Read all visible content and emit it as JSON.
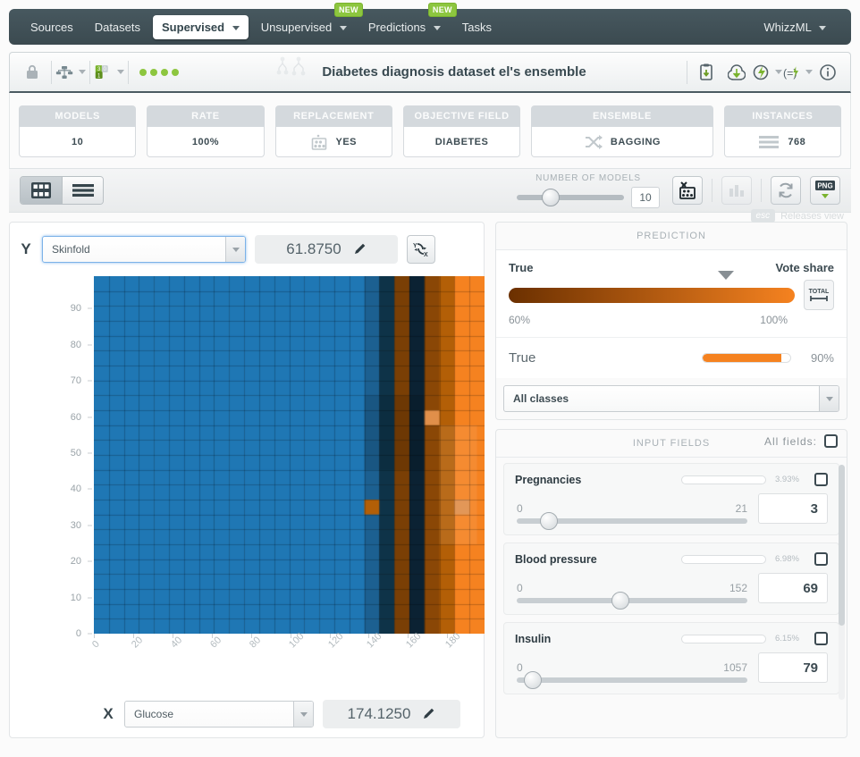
{
  "nav": {
    "items": [
      {
        "label": "Sources",
        "dropdown": false,
        "active": false,
        "badge": null
      },
      {
        "label": "Datasets",
        "dropdown": false,
        "active": false,
        "badge": null
      },
      {
        "label": "Supervised",
        "dropdown": true,
        "active": true,
        "badge": null
      },
      {
        "label": "Unsupervised",
        "dropdown": true,
        "active": false,
        "badge": "NEW"
      },
      {
        "label": "Predictions",
        "dropdown": true,
        "active": false,
        "badge": "NEW"
      },
      {
        "label": "Tasks",
        "dropdown": false,
        "active": false,
        "badge": null
      }
    ],
    "right": {
      "label": "WhizzML",
      "dropdown": true
    }
  },
  "resource_header": {
    "title": "Diabetes diagnosis dataset el's ensemble",
    "left_icons": [
      "lock-icon",
      "tree-network-icon",
      "fields-count-icon"
    ],
    "status_dots": 4,
    "right_icons": [
      "clipboard-download-icon",
      "cloud-download-icon",
      "flash-actions-icon",
      "script-actions-icon",
      "info-icon"
    ]
  },
  "metrics": [
    {
      "label": "MODELS",
      "value": "10",
      "icon": null
    },
    {
      "label": "RATE",
      "value": "100%",
      "icon": null
    },
    {
      "label": "REPLACEMENT",
      "value": "YES",
      "icon": "sampling-bucket-icon"
    },
    {
      "label": "OBJECTIVE FIELD",
      "value": "DIABETES",
      "icon": null
    },
    {
      "label": "ENSEMBLE",
      "value": "BAGGING",
      "icon": "shuffle-icon"
    },
    {
      "label": "INSTANCES",
      "value": "768",
      "icon": "rows-icon"
    }
  ],
  "toolbar": {
    "view_grid_icon": "grid-view-icon",
    "view_list_icon": "list-view-icon",
    "slider_label": "NUMBER OF MODELS",
    "slider_value": "10",
    "slider_min": 1,
    "slider_max": 10,
    "sample_icon": "sampling-bucket-icon",
    "chart_icon": "bar-chart-icon",
    "refresh_icon": "refresh-icon",
    "export_label": "PNG",
    "export_icon": "png-download-icon"
  },
  "esc_hint": {
    "key": "esc",
    "text": "Releases view"
  },
  "chart_panel": {
    "y_axis": {
      "letter": "Y",
      "field": "Skinfold",
      "value": "61.8750",
      "edit_icon": "pencil-icon",
      "swap_icon": "swap-axes-icon"
    },
    "x_axis": {
      "letter": "X",
      "field": "Glucose",
      "value": "174.1250",
      "edit_icon": "pencil-icon"
    }
  },
  "chart_data": {
    "type": "heatmap",
    "title": "",
    "xlabel": "Glucose",
    "ylabel": "Skinfold",
    "xlim": [
      0,
      199
    ],
    "ylim": [
      0,
      99
    ],
    "xticks": [
      0,
      20,
      40,
      60,
      80,
      100,
      120,
      140,
      160,
      180
    ],
    "yticks": [
      0,
      10,
      20,
      30,
      40,
      50,
      60,
      70,
      80,
      90
    ],
    "grid": true,
    "cols": 26,
    "rows": 24,
    "legend": "none",
    "classes": [
      {
        "name": "False",
        "color": "#1f77b4"
      },
      {
        "name": "True",
        "color": "#f58220"
      }
    ],
    "column_bands": [
      {
        "from_col": 0,
        "to_col": 17,
        "color": "#1f77b4",
        "class": "False",
        "confidence": "high"
      },
      {
        "from_col": 18,
        "to_col": 18,
        "color": "#1c6091",
        "class": "False",
        "confidence": "medium"
      },
      {
        "from_col": 19,
        "to_col": 19,
        "color": "#0e3348",
        "class": "False",
        "confidence": "low"
      },
      {
        "from_col": 20,
        "to_col": 20,
        "color": "#7a3f05",
        "class": "True",
        "confidence": "low"
      },
      {
        "from_col": 21,
        "to_col": 21,
        "color": "#0b2233",
        "class": "False",
        "confidence": "low"
      },
      {
        "from_col": 22,
        "to_col": 22,
        "color": "#8a4706",
        "class": "True",
        "confidence": "low"
      },
      {
        "from_col": 23,
        "to_col": 23,
        "color": "#b35f07",
        "class": "True",
        "confidence": "medium"
      },
      {
        "from_col": 24,
        "to_col": 25,
        "color": "#f58220",
        "class": "True",
        "confidence": "high"
      }
    ],
    "notable_cells": [
      {
        "col": 22,
        "row": 9,
        "color": "#e08f4a",
        "note": "lighter orange cell near x=168, y=63"
      },
      {
        "col": 18,
        "row": 15,
        "color": "#b35f07",
        "note": "orange cell inside dark band near x=140, y=33"
      },
      {
        "col": 24,
        "row": 15,
        "color": "#e08f4a",
        "note": "light orange cell near x=184, y=31"
      }
    ]
  },
  "prediction": {
    "panel_title": "PREDICTION",
    "class_label": "True",
    "measure_label": "Vote share",
    "range_min": "60%",
    "range_max": "100%",
    "marker_position_pct": 78,
    "total_button": "TOTAL",
    "rows": [
      {
        "name": "True",
        "percent": "90%",
        "fill_pct": 90
      }
    ],
    "class_filter": "All classes"
  },
  "input_fields": {
    "panel_title": "INPUT FIELDS",
    "all_fields_label": "All fields:",
    "all_fields_checked": false,
    "fields": [
      {
        "name": "Pregnancies",
        "importance": "3.93%",
        "importance_pct": 3.93,
        "min": "0",
        "max": "21",
        "value": "3",
        "slider_pct": 14,
        "checked": false
      },
      {
        "name": "Blood pressure",
        "importance": "6.98%",
        "importance_pct": 6.98,
        "min": "0",
        "max": "152",
        "value": "69",
        "slider_pct": 45,
        "checked": false
      },
      {
        "name": "Insulin",
        "importance": "6.15%",
        "importance_pct": 6.15,
        "min": "0",
        "max": "1057",
        "value": "79",
        "slider_pct": 7,
        "checked": false
      }
    ]
  },
  "colors": {
    "nav_bg": "#3f5057",
    "accent_green": "#8dc63f",
    "orange": "#f58220",
    "blue": "#1f77b4",
    "dark_text": "#3c4a51"
  }
}
